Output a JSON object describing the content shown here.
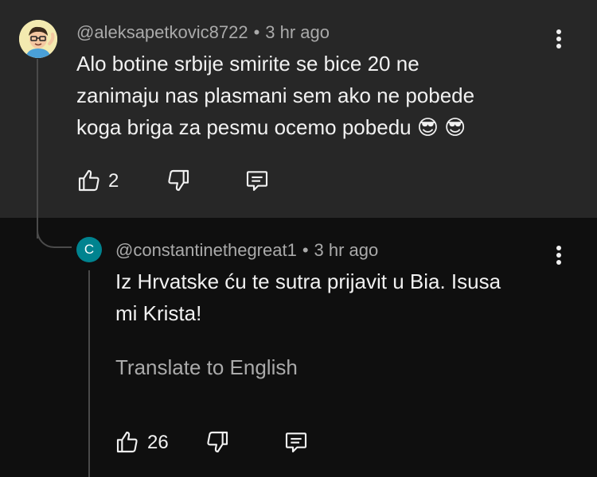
{
  "parent_comment": {
    "handle": "@aleksapetkovic8722",
    "separator": "•",
    "time": "3 hr ago",
    "text_line1": "Alo botine srbije smirite se bice 20 ne",
    "text_line2": "zanimaju nas plasmani sem ako ne pobede",
    "text_line3": "koga briga za pesmu ocemo pobedu",
    "emoji": "😎 😎",
    "like_count": "2"
  },
  "reply_comment": {
    "avatar_letter": "C",
    "handle": "@constantinethegreat1",
    "separator": "•",
    "time": "3 hr ago",
    "text_line1": "Iz Hrvatske ću te sutra prijavit u Bia. Isusa",
    "text_line2": "mi Krista!",
    "translate_label": "Translate to English",
    "like_count": "26"
  },
  "colors": {
    "parent_background": "#272727",
    "page_background": "#0f0f0f",
    "reply_avatar": "#00838f",
    "secondary_text": "#aaaaaa"
  },
  "icons": [
    "thumb-up-icon",
    "thumb-down-icon",
    "reply-icon",
    "more-vert-icon"
  ]
}
